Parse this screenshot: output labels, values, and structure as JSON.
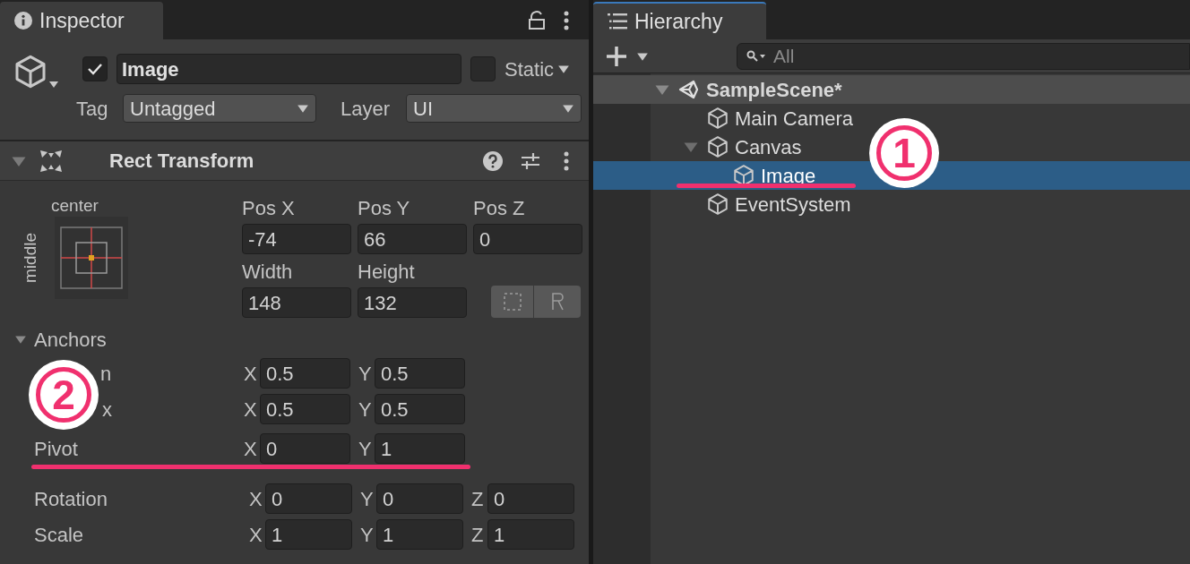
{
  "inspector": {
    "tab": {
      "title": "Inspector",
      "selected": true
    },
    "object": {
      "active": true,
      "name": "Image",
      "static": false,
      "static_label": "Static",
      "tag_label": "Tag",
      "tag": "Untagged",
      "layer_label": "Layer",
      "layer": "UI"
    },
    "component": {
      "title": "Rect Transform",
      "expanded": true,
      "anchor_preset": {
        "horizontal": "center",
        "vertical": "middle"
      },
      "position_fields": [
        {
          "label": "Pos X",
          "value": "-74"
        },
        {
          "label": "Pos Y",
          "value": "66"
        },
        {
          "label": "Pos Z",
          "value": "0"
        }
      ],
      "size_fields": [
        {
          "label": "Width",
          "value": "148"
        },
        {
          "label": "Height",
          "value": "132"
        }
      ],
      "anchors": {
        "label": "Anchors",
        "expanded": true,
        "rows": [
          {
            "label": "n",
            "fields": [
              {
                "axis": "X",
                "value": "0.5"
              },
              {
                "axis": "Y",
                "value": "0.5"
              }
            ]
          },
          {
            "label": "x",
            "fields": [
              {
                "axis": "X",
                "value": "0.5"
              },
              {
                "axis": "Y",
                "value": "0.5"
              }
            ]
          }
        ]
      },
      "pivot": {
        "label": "Pivot",
        "fields": [
          {
            "axis": "X",
            "value": "0"
          },
          {
            "axis": "Y",
            "value": "1"
          }
        ]
      },
      "rotation": {
        "label": "Rotation",
        "fields": [
          {
            "axis": "X",
            "value": "0"
          },
          {
            "axis": "Y",
            "value": "0"
          },
          {
            "axis": "Z",
            "value": "0"
          }
        ]
      },
      "scale": {
        "label": "Scale",
        "fields": [
          {
            "axis": "X",
            "value": "1"
          },
          {
            "axis": "Y",
            "value": "1"
          },
          {
            "axis": "Z",
            "value": "1"
          }
        ]
      }
    }
  },
  "hierarchy": {
    "tab": {
      "title": "Hierarchy",
      "selected": true
    },
    "search": {
      "placeholder": "All"
    },
    "tree": [
      {
        "name": "SampleScene*",
        "kind": "scene",
        "expanded": true,
        "selected": false,
        "children": [
          {
            "name": "Main Camera",
            "kind": "object",
            "selected": false
          },
          {
            "name": "Canvas",
            "kind": "object",
            "expanded": true,
            "selected": false,
            "children": [
              {
                "name": "Image",
                "kind": "object",
                "selected": true
              }
            ]
          },
          {
            "name": "EventSystem",
            "kind": "object",
            "selected": false
          }
        ]
      }
    ]
  },
  "annotations": [
    {
      "number": "1"
    },
    {
      "number": "2"
    }
  ]
}
